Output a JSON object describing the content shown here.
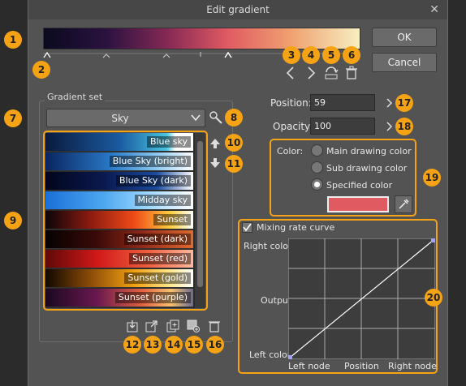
{
  "window": {
    "title": "Edit gradient"
  },
  "buttons": {
    "ok": "OK",
    "cancel": "Cancel"
  },
  "gradient_set": {
    "group_label": "Gradient set",
    "selected": "Sky",
    "items": [
      {
        "label": "Blue sky"
      },
      {
        "label": "Blue Sky (bright)"
      },
      {
        "label": "Blue Sky (dark)"
      },
      {
        "label": "Midday sky"
      },
      {
        "label": "Sunset"
      },
      {
        "label": "Sunset (dark)"
      },
      {
        "label": "Sunset (red)"
      },
      {
        "label": "Sunset (gold)"
      },
      {
        "label": "Sunset (purple)"
      }
    ]
  },
  "position": {
    "label": "Position:",
    "value": "59"
  },
  "opacity": {
    "label": "Opacity:",
    "value": "100"
  },
  "color": {
    "label": "Color:",
    "options": [
      "Main drawing color",
      "Sub drawing color",
      "Specified color"
    ],
    "selected_index": 2,
    "specified_swatch": "#e05a62"
  },
  "curve": {
    "checkbox_label": "Mixing rate curve",
    "checked": true,
    "right_color": "Right color",
    "output": "Output",
    "left_color": "Left color",
    "left_node": "Left node",
    "position": "Position",
    "right_node": "Right node"
  },
  "badges": [
    "1",
    "2",
    "3",
    "4",
    "5",
    "6",
    "7",
    "8",
    "9",
    "10",
    "11",
    "12",
    "13",
    "14",
    "15",
    "16",
    "17",
    "18",
    "19",
    "20"
  ]
}
